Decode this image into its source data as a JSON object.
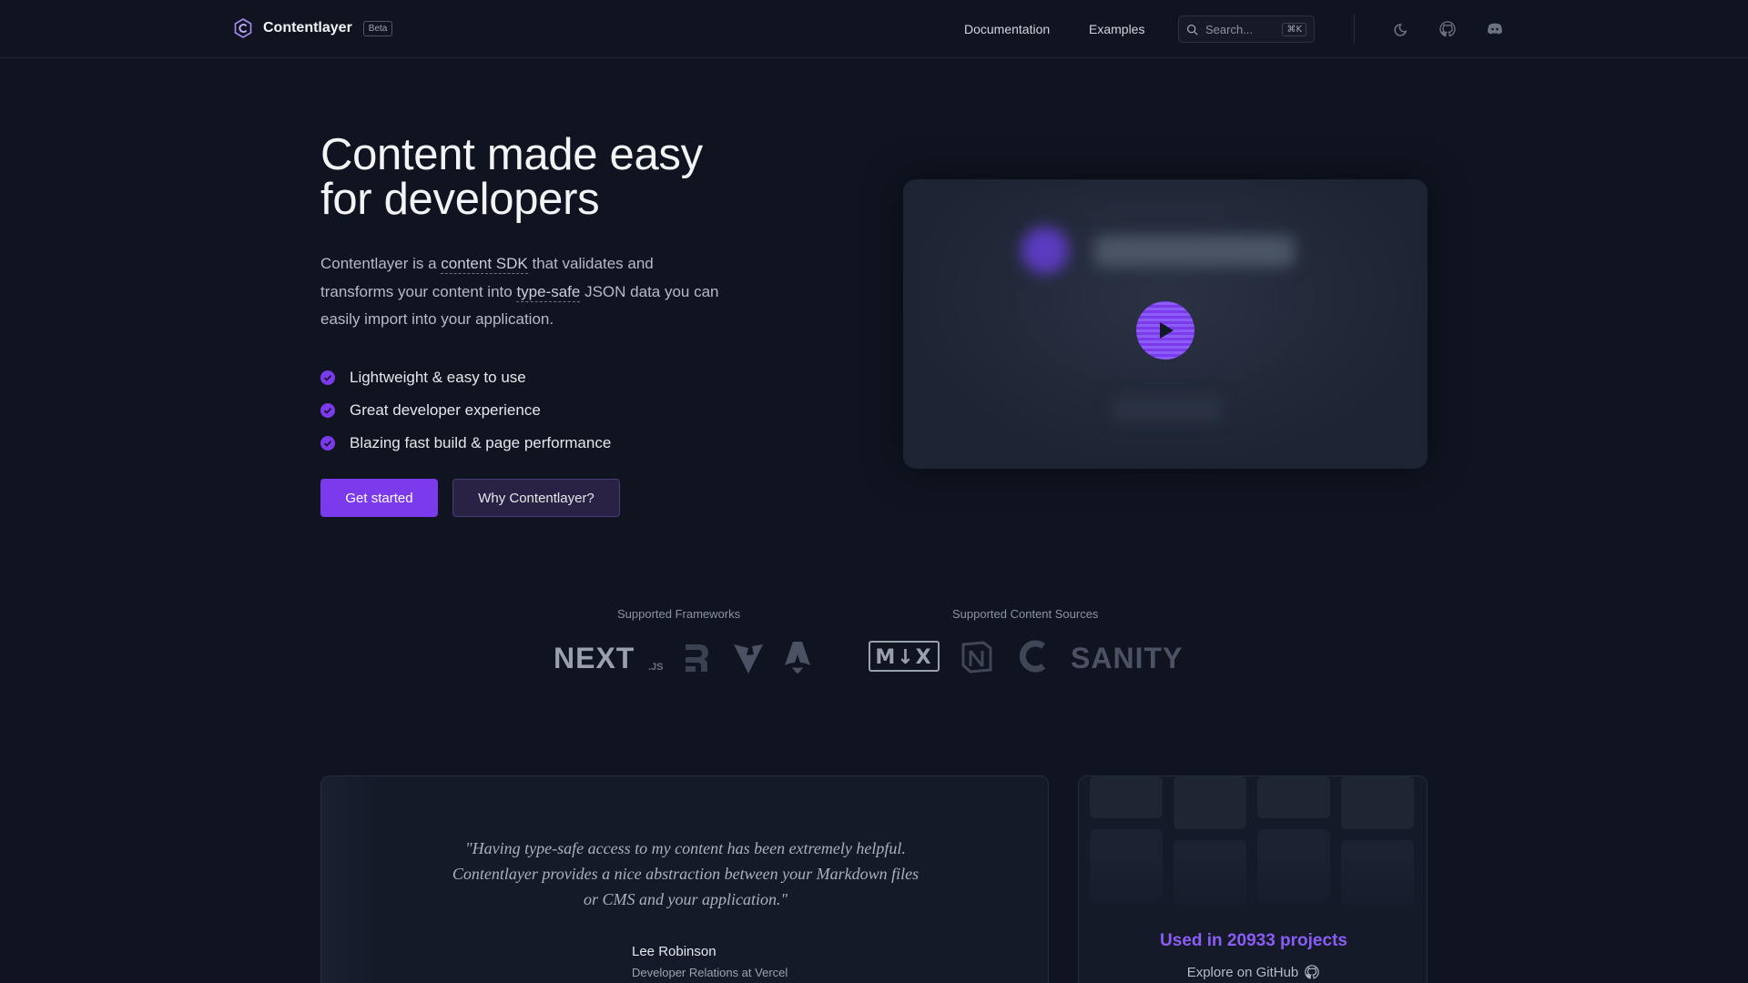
{
  "header": {
    "brand_name": "Contentlayer",
    "badge": "Beta",
    "nav": {
      "documentation": "Documentation",
      "examples": "Examples"
    },
    "search": {
      "placeholder": "Search...",
      "shortcut": "⌘K"
    },
    "icons": [
      "theme-toggle-icon",
      "github-icon",
      "discord-icon"
    ]
  },
  "hero": {
    "title_line1": "Content made easy",
    "title_line2": "for developers",
    "desc": {
      "part1": "Contentlayer is a ",
      "link1": "content SDK",
      "part2": " that validates and transforms your content into ",
      "link2": "type-safe",
      "part3": " JSON data you can easily import into your application."
    },
    "features": [
      "Lightweight & easy to use",
      "Great developer experience",
      "Blazing fast build & page performance"
    ],
    "primary_button": "Get started",
    "secondary_button": "Why Contentlayer?"
  },
  "supported": {
    "frameworks_label": "Supported Frameworks",
    "frameworks": [
      "nextjs-logo",
      "remix-logo",
      "vite-logo",
      "astro-logo"
    ],
    "sources_label": "Supported Content Sources",
    "sources": [
      "mdx-logo",
      "notion-logo",
      "contentful-logo",
      "sanity-logo"
    ],
    "logo_text": {
      "next": "NEXT",
      "js": ".JS",
      "mdx": "M↓X",
      "sanity": "SANITY"
    }
  },
  "testimonial": {
    "quote": "\"Having type-safe access to my content has been extremely helpful. Contentlayer provides a nice abstraction between your Markdown files or CMS and your application.\"",
    "name": "Lee Robinson",
    "role": "Developer Relations at Vercel"
  },
  "github_card": {
    "used_text": "Used in 20933 projects",
    "explore_text": "Explore on GitHub"
  },
  "colors": {
    "background": "#0f1420",
    "accent": "#7c3aed",
    "accent_text": "#8b5cf6"
  }
}
